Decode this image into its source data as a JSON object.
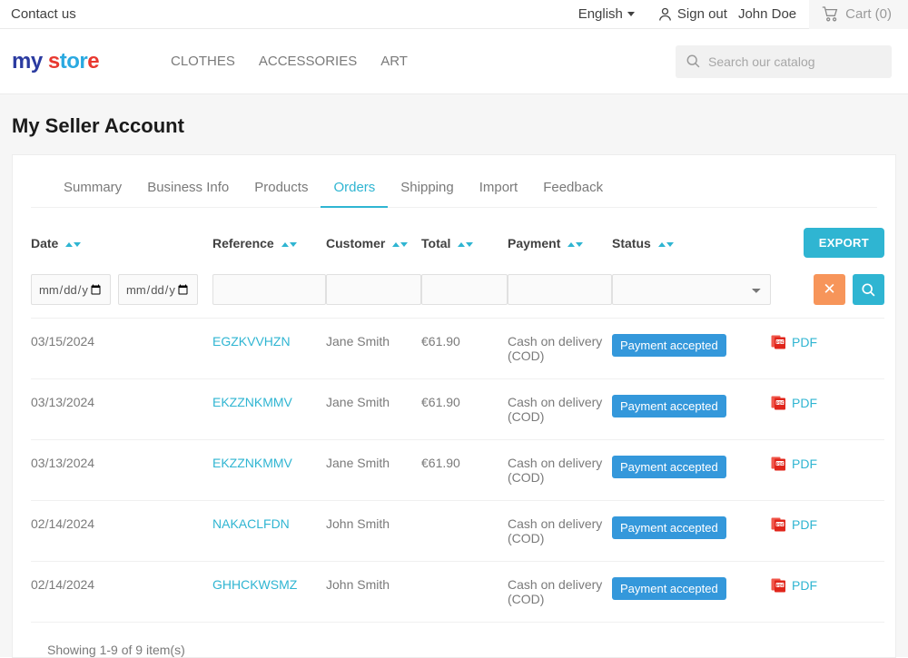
{
  "topbar": {
    "contact": "Contact us",
    "language": "English",
    "language_caret": "chevron-down-icon",
    "sign_out": "Sign out",
    "user_name": "John Doe",
    "cart": "Cart (0)"
  },
  "header": {
    "logo": {
      "part1": "my",
      "part2": "s",
      "part3": "tor",
      "part4": "e"
    },
    "nav": [
      "CLOTHES",
      "ACCESSORIES",
      "ART"
    ],
    "search_placeholder": "Search our catalog",
    "search_value": ""
  },
  "page": {
    "title": "My Seller Account"
  },
  "tabs": [
    {
      "label": "Summary",
      "active": false
    },
    {
      "label": "Business Info",
      "active": false
    },
    {
      "label": "Products",
      "active": false
    },
    {
      "label": "Orders",
      "active": true
    },
    {
      "label": "Shipping",
      "active": false
    },
    {
      "label": "Import",
      "active": false
    },
    {
      "label": "Feedback",
      "active": false
    }
  ],
  "table": {
    "columns": [
      "Date",
      "Reference",
      "Customer",
      "Total",
      "Payment",
      "Status"
    ],
    "export_label": "EXPORT",
    "filters": {
      "date_from_placeholder": "mm/dd/yyyy",
      "date_to_placeholder": "mm/dd/yyyy",
      "date_from_value": "",
      "date_to_value": "",
      "reference_value": "",
      "customer_value": "",
      "total_value": "",
      "payment_value": "",
      "status_selected": "",
      "status_options": [
        ""
      ],
      "clear_label": "✕",
      "search_label": "search-icon"
    },
    "rows": [
      {
        "date": "03/15/2024",
        "reference": "EGZKVVHZN",
        "customer": "Jane Smith",
        "total": "€61.90",
        "payment": "Cash on delivery (COD)",
        "status": "Payment accepted",
        "pdf": "PDF"
      },
      {
        "date": "03/13/2024",
        "reference": "EKZZNKMMV",
        "customer": "Jane Smith",
        "total": "€61.90",
        "payment": "Cash on delivery (COD)",
        "status": "Payment accepted",
        "pdf": "PDF"
      },
      {
        "date": "03/13/2024",
        "reference": "EKZZNKMMV",
        "customer": "Jane Smith",
        "total": "€61.90",
        "payment": "Cash on delivery (COD)",
        "status": "Payment accepted",
        "pdf": "PDF"
      },
      {
        "date": "02/14/2024",
        "reference": "NAKACLFDN",
        "customer": "John Smith",
        "total": "",
        "payment": "Cash on delivery (COD)",
        "status": "Payment accepted",
        "pdf": "PDF"
      },
      {
        "date": "02/14/2024",
        "reference": "GHHCKWSMZ",
        "customer": "John Smith",
        "total": "",
        "payment": "Cash on delivery (COD)",
        "status": "Payment accepted",
        "pdf": "PDF"
      }
    ],
    "showing": "Showing 1-9 of 9 item(s)"
  },
  "colors": {
    "accent": "#2fb5d2",
    "badge": "#3498db",
    "clear_button": "#f7955a",
    "page_bg": "#f6f6f6"
  }
}
